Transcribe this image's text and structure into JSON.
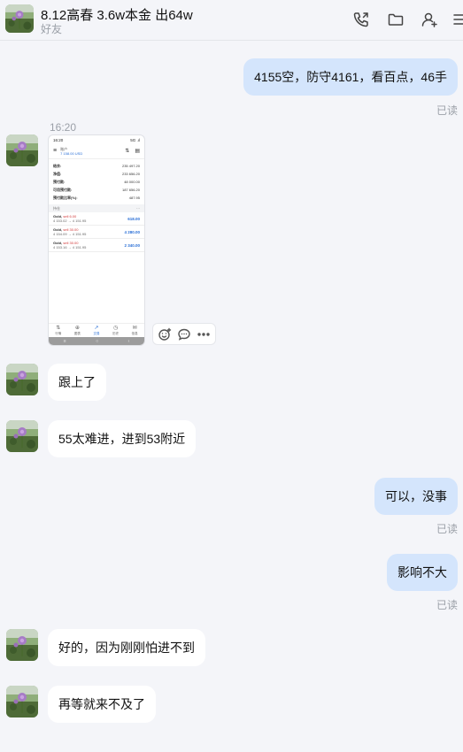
{
  "header": {
    "title": "8.12高春 3.6w本金 出64w",
    "subtitle": "好友",
    "icons": [
      "phone-icon",
      "folder-icon",
      "add-contact-icon",
      "more-icon"
    ]
  },
  "messages": [
    {
      "side": "out",
      "text": "4155空，防守4161，看百点，46手",
      "status": "已读"
    },
    {
      "side": "in",
      "time": "16:20",
      "type": "image"
    },
    {
      "side": "in",
      "text": "跟上了"
    },
    {
      "side": "in",
      "text": "55太难进，进到53附近"
    },
    {
      "side": "out",
      "text": "可以，没事",
      "status": "已读"
    },
    {
      "side": "out",
      "text": "影响不大",
      "status": "已读"
    },
    {
      "side": "in",
      "text": "好的，因为刚刚怕进不到"
    },
    {
      "side": "in",
      "text": "再等就来不及了"
    }
  ],
  "screenshot": {
    "status_time": "16:20",
    "status_right": "5G .ıl",
    "account_label": "账户",
    "balance": "7 158.00 USD",
    "account_rows": [
      {
        "label": "结余:",
        "value": "235 497.20"
      },
      {
        "label": "净值:",
        "value": "233 656.20"
      },
      {
        "label": "预付款:",
        "value": "48 000.00"
      },
      {
        "label": "可用预付款:",
        "value": "187 656.20"
      },
      {
        "label": "预付款比率(%):",
        "value": "487.95"
      }
    ],
    "section_label": "持仓",
    "section_more": "···",
    "positions": [
      {
        "symbol": "Gold,",
        "side": "sell 6.00",
        "range": "4 153.02 → 4 151.95",
        "pl": "618.00"
      },
      {
        "symbol": "Gold,",
        "side": "sell 30.00",
        "range": "4 154.09 → 4 151.95",
        "pl": "4 280.00"
      },
      {
        "symbol": "Gold,",
        "side": "sell 30.00",
        "range": "4 153.16 → 4 151.95",
        "pl": "2 340.00"
      }
    ],
    "nav": [
      {
        "icon": "⇅",
        "label": "行情"
      },
      {
        "icon": "⊕",
        "label": "图表"
      },
      {
        "icon": "↗",
        "label": "交易"
      },
      {
        "icon": "◷",
        "label": "历史"
      },
      {
        "icon": "✉",
        "label": "信息"
      }
    ]
  },
  "image_actions": [
    "emoji-add-icon",
    "comment-icon",
    "more-dots-icon"
  ]
}
